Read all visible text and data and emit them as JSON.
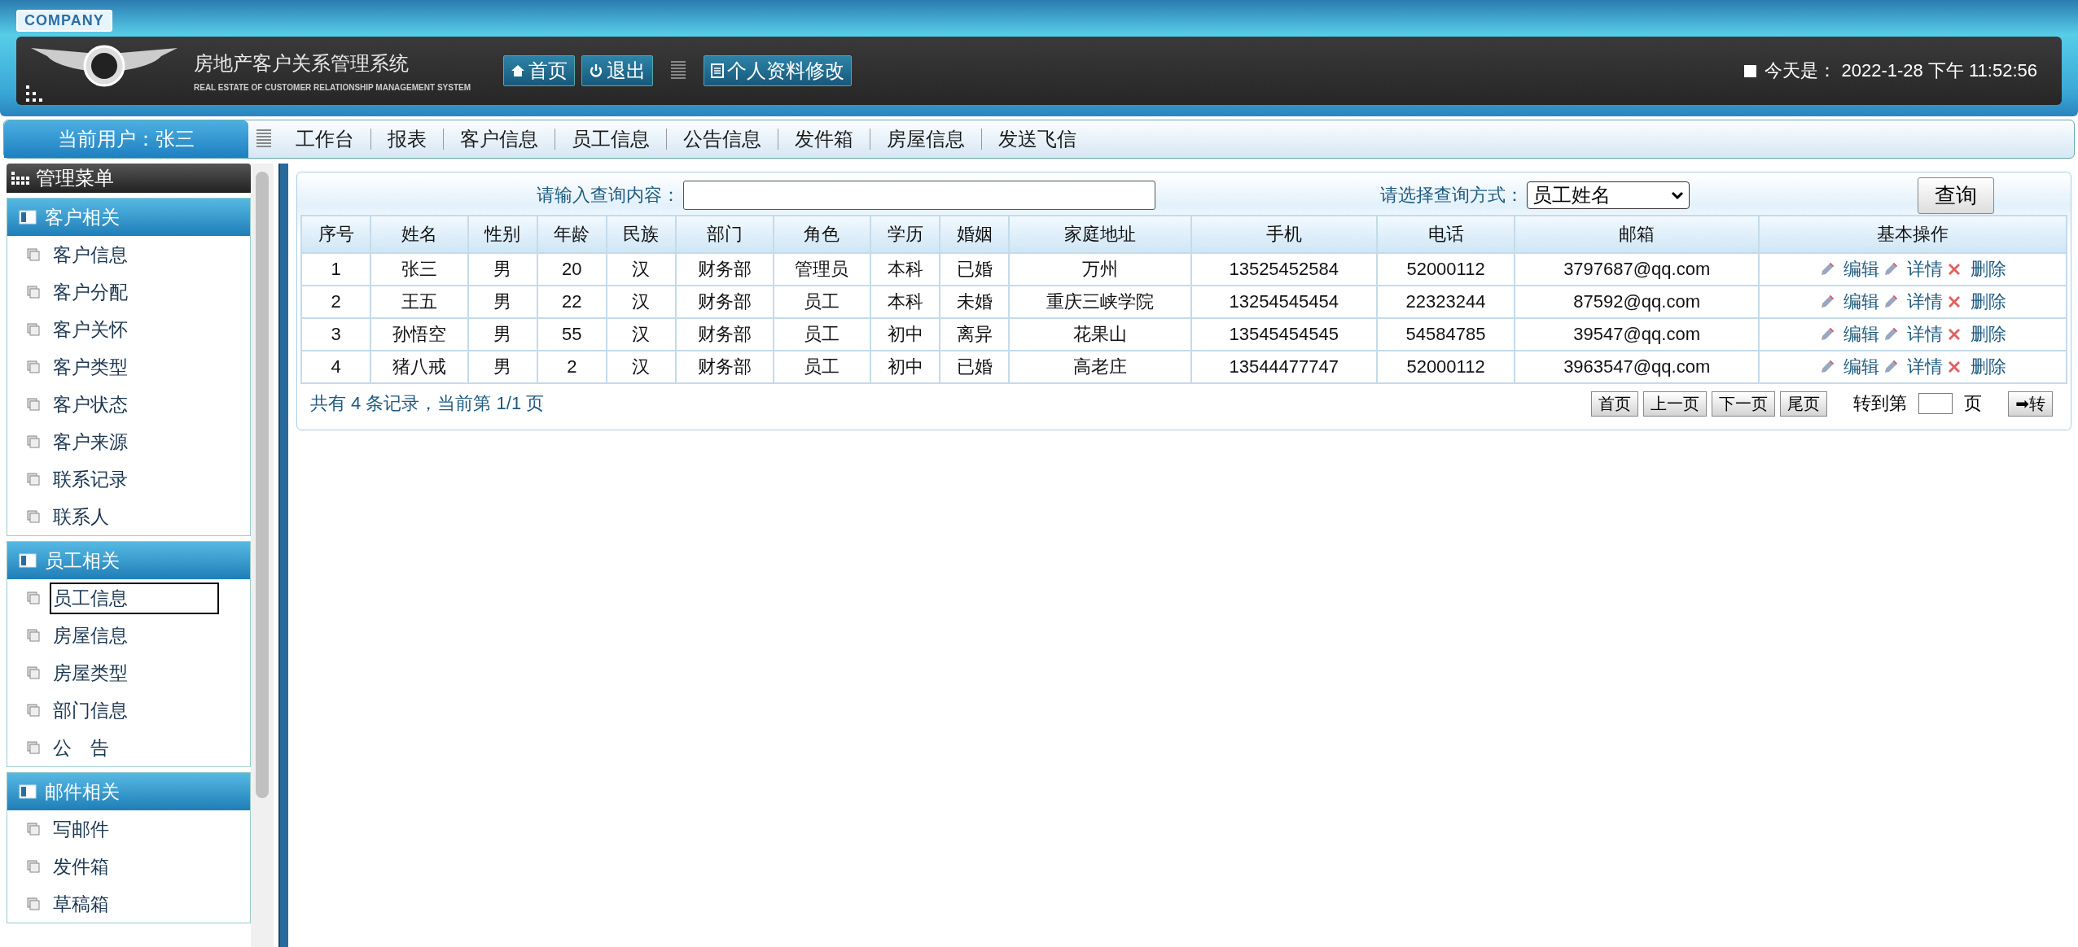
{
  "header": {
    "badge": "COMPANY",
    "title": "房地产客户关系管理系统",
    "subtitle": "REAL ESTATE OF CUSTOMER RELATIONSHIP MANAGEMENT SYSTEM",
    "buttons": [
      {
        "label": "首页",
        "kind": "home"
      },
      {
        "label": "退出",
        "kind": "power"
      },
      {
        "label": "个人资料修改",
        "kind": "doc"
      }
    ],
    "date_label": "今天是：",
    "date": "2022-1-28 下午 11:52:56"
  },
  "nav": {
    "user": "当前用户：张三",
    "items": [
      "工作台",
      "报表",
      "客户信息",
      "员工信息",
      "公告信息",
      "发件箱",
      "房屋信息",
      "发送飞信"
    ]
  },
  "sidebar": {
    "title": "管理菜单",
    "groups": [
      {
        "label": "客户相关",
        "items": [
          {
            "label": "客户信息",
            "selected": false
          },
          {
            "label": "客户分配",
            "selected": false
          },
          {
            "label": "客户关怀",
            "selected": false
          },
          {
            "label": "客户类型",
            "selected": false
          },
          {
            "label": "客户状态",
            "selected": false
          },
          {
            "label": "客户来源",
            "selected": false
          },
          {
            "label": "联系记录",
            "selected": false
          },
          {
            "label": "联系人",
            "selected": false
          }
        ]
      },
      {
        "label": "员工相关",
        "items": [
          {
            "label": "员工信息",
            "selected": true
          },
          {
            "label": "房屋信息",
            "selected": false
          },
          {
            "label": "房屋类型",
            "selected": false
          },
          {
            "label": "部门信息",
            "selected": false
          },
          {
            "label": "公　告",
            "selected": false
          }
        ]
      },
      {
        "label": "邮件相关",
        "items": [
          {
            "label": "写邮件",
            "selected": false
          },
          {
            "label": "发件箱",
            "selected": false
          },
          {
            "label": "草稿箱",
            "selected": false
          }
        ]
      }
    ]
  },
  "search": {
    "label": "请输入查询内容：",
    "mode_label": "请选择查询方式：",
    "mode": "员工姓名",
    "button": "查询"
  },
  "table": {
    "columns": [
      "序号",
      "姓名",
      "性别",
      "年龄",
      "民族",
      "部门",
      "角色",
      "学历",
      "婚姻",
      "家庭地址",
      "手机",
      "电话",
      "邮箱",
      "基本操作"
    ],
    "rows": [
      {
        "cells": [
          "1",
          "张三",
          "男",
          "20",
          "汉",
          "财务部",
          "管理员",
          "本科",
          "已婚",
          "万州",
          "13525452584",
          "52000112",
          "3797687@qq.com"
        ],
        "actions": [
          {
            "label": "编辑",
            "kind": "edit"
          },
          {
            "label": "详情",
            "kind": "edit"
          },
          {
            "label": "删除",
            "kind": "delete"
          }
        ]
      },
      {
        "cells": [
          "2",
          "王五",
          "男",
          "22",
          "汉",
          "财务部",
          "员工",
          "本科",
          "未婚",
          "重庆三峡学院",
          "13254545454",
          "22323244",
          "87592@qq.com"
        ],
        "actions": [
          {
            "label": "编辑",
            "kind": "edit"
          },
          {
            "label": "详情",
            "kind": "edit"
          },
          {
            "label": "删除",
            "kind": "delete"
          }
        ]
      },
      {
        "cells": [
          "3",
          "孙悟空",
          "男",
          "55",
          "汉",
          "财务部",
          "员工",
          "初中",
          "离异",
          "花果山",
          "13545454545",
          "54584785",
          "39547@qq.com"
        ],
        "actions": [
          {
            "label": "编辑",
            "kind": "edit"
          },
          {
            "label": "详情",
            "kind": "edit"
          },
          {
            "label": "删除",
            "kind": "delete"
          }
        ]
      },
      {
        "cells": [
          "4",
          "猪八戒",
          "男",
          "2",
          "汉",
          "财务部",
          "员工",
          "初中",
          "已婚",
          "高老庄",
          "13544477747",
          "52000112",
          "3963547@qq.com"
        ],
        "actions": [
          {
            "label": "编辑",
            "kind": "edit"
          },
          {
            "label": "详情",
            "kind": "edit"
          },
          {
            "label": "删除",
            "kind": "delete"
          }
        ]
      }
    ]
  },
  "pager": {
    "summary": "共有 4 条记录，当前第 1/1 页",
    "buttons": [
      "首页",
      "上一页",
      "下一页",
      "尾页"
    ],
    "goto_label": "转到第",
    "goto_unit": "页",
    "go": "➡转"
  }
}
